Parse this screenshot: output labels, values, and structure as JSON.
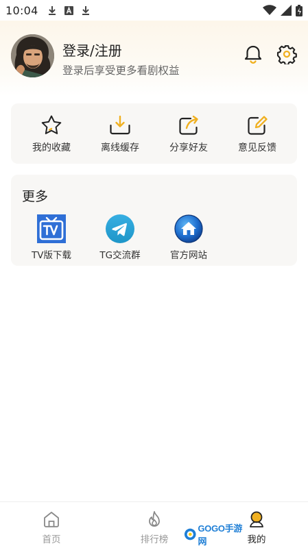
{
  "status_bar": {
    "time": "10:04",
    "notification_icons": [
      "download-icon",
      "text-a-icon",
      "download-icon"
    ],
    "system_icons": [
      "wifi-icon",
      "signal-icon",
      "battery-charging-icon"
    ]
  },
  "profile": {
    "title": "登录/注册",
    "subtitle": "登录后享受更多看剧权益",
    "actions": [
      "bell-icon",
      "gear-icon"
    ]
  },
  "quick_actions": [
    {
      "label": "我的收藏",
      "icon": "star-icon"
    },
    {
      "label": "离线缓存",
      "icon": "download-tray-icon"
    },
    {
      "label": "分享好友",
      "icon": "share-icon"
    },
    {
      "label": "意见反馈",
      "icon": "edit-icon"
    }
  ],
  "more": {
    "title": "更多",
    "items": [
      {
        "label": "TV版下载",
        "icon": "tv-icon",
        "color": "#2f6fd6"
      },
      {
        "label": "TG交流群",
        "icon": "telegram-icon",
        "color": "#2fa3e0"
      },
      {
        "label": "官方网站",
        "icon": "home-globe-icon",
        "color": "#1a62c4"
      }
    ]
  },
  "tabbar": {
    "items": [
      {
        "label": "首页",
        "icon": "home-icon"
      },
      {
        "label": "排行榜",
        "icon": "flame-icon"
      },
      {
        "label": "我的",
        "icon": "user-icon",
        "active": true
      }
    ]
  },
  "watermark": {
    "text": "GOGO手游网"
  },
  "colors": {
    "accent": "#f0b020",
    "card_bg": "#f8f7f5",
    "header_tint": "#fdf6ea"
  }
}
